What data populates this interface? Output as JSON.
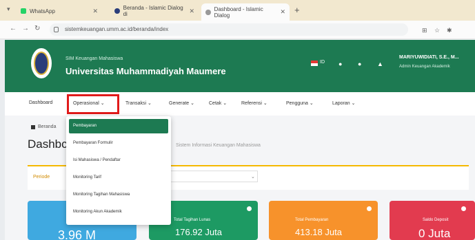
{
  "browser": {
    "tabs": [
      {
        "label": "WhatsApp",
        "favicon_color": "#25d366"
      },
      {
        "label": "Beranda - Islamic Dialog di",
        "favicon_color": "#2a3d7a"
      },
      {
        "label": "Dashboard - Islamic Dialog",
        "favicon_color": "#999999"
      }
    ],
    "url": "sistemkeuangan.umm.ac.id/beranda/index"
  },
  "header": {
    "subtitle": "SIM Keuangan Mahasiswa",
    "university": "Universitas Muhammadiyah Maumere",
    "language": "ID",
    "user_name": "MARIYUWIDIATI, S.E., M...",
    "user_role": "Admin Keuangan Akademik",
    "brand_color": "#1d7a52"
  },
  "nav": {
    "items": [
      "Dashboard",
      "Operasional",
      "Transaksi",
      "Generate",
      "Cetak",
      "Referensi",
      "Pengguna",
      "Laporan"
    ]
  },
  "breadcrumb": "Beranda",
  "page": {
    "title": "Dashbc",
    "subtitle": "Sistem Informasi Keuangan Mahasiswa"
  },
  "filter": {
    "label": "Periode"
  },
  "dropdown": {
    "items": [
      "Pembayaran",
      "Pembayaran Formulir",
      "Isi Mahasiswa / Pendaftar",
      "Monitoring Tarif",
      "Monitoring Tagihan Mahasiswa",
      "Monitoring Akun Akademik"
    ]
  },
  "cards": [
    {
      "title": "",
      "value": "3.96 M",
      "color": "#3fa9e0"
    },
    {
      "title": "Total Tagihan Lunas",
      "value": "176.92 Juta",
      "color": "#1d9a63"
    },
    {
      "title": "Total Pembayaran",
      "value": "413.18 Juta",
      "color": "#f7922b"
    },
    {
      "title": "Saldo Deposit",
      "value": "0 Juta",
      "color": "#e23b4f"
    }
  ]
}
